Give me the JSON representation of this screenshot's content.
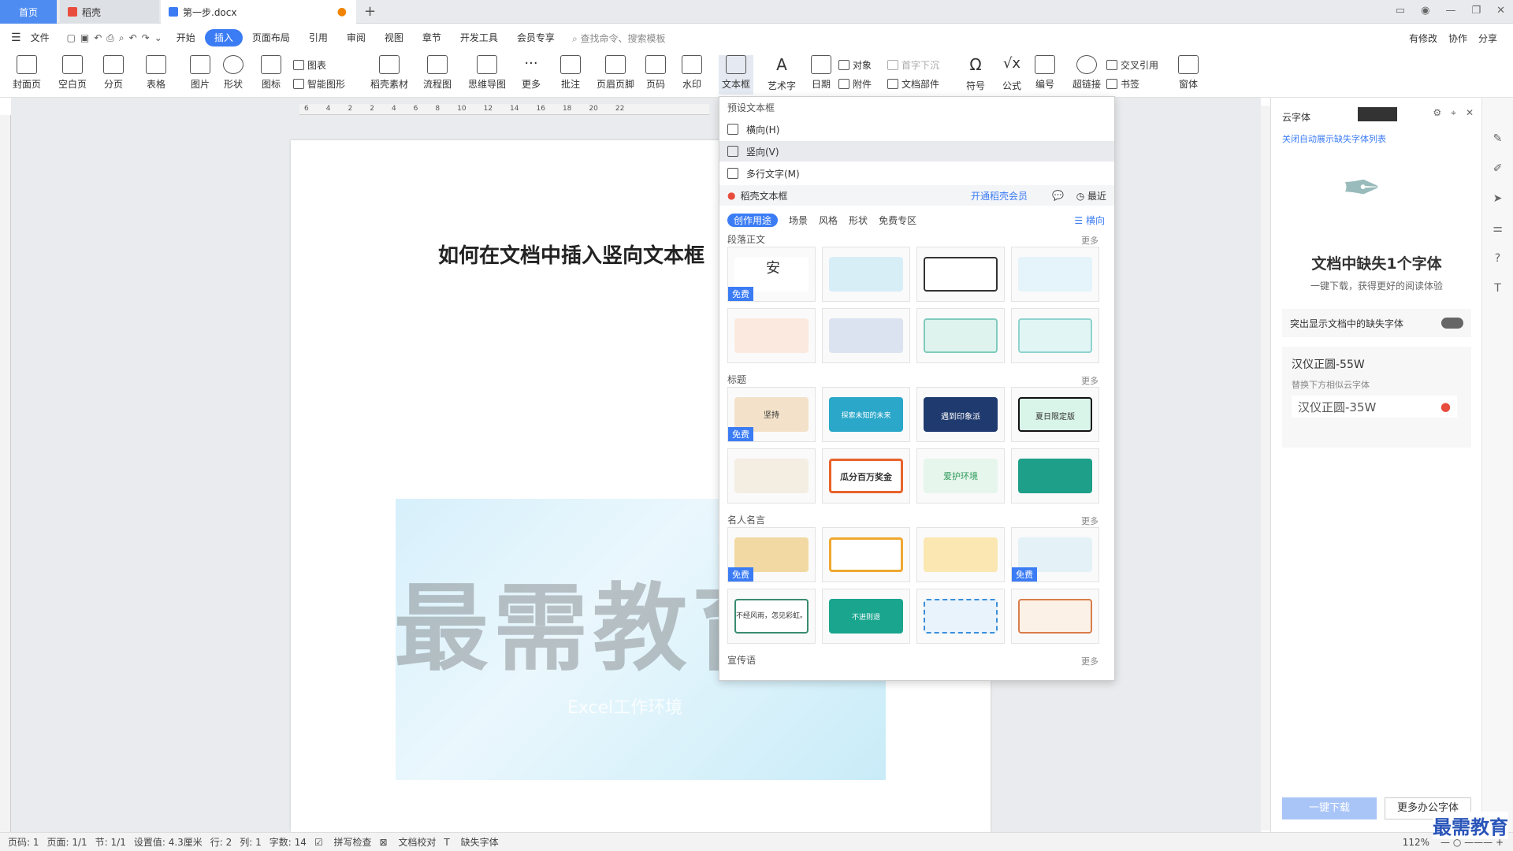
{
  "tabs": {
    "home": "首页",
    "daoke": "稻壳",
    "doc": "第一步.docx",
    "new": "+"
  },
  "menu": {
    "file": "文件",
    "items": [
      "开始",
      "插入",
      "页面布局",
      "引用",
      "审阅",
      "视图",
      "章节",
      "开发工具",
      "会员专享"
    ],
    "search": "查找命令、搜索模板",
    "right": [
      "有修改",
      "协作",
      "分享"
    ]
  },
  "ribbon": {
    "cover": "封面页",
    "blank": "空白页",
    "break": "分页",
    "table": "表格",
    "picture": "图片",
    "shape": "形状",
    "icon": "图标",
    "chart": "图表",
    "smart": "智能图形",
    "material": "稻壳素材",
    "flow": "流程图",
    "mind": "思维导图",
    "more": "更多",
    "comment": "批注",
    "header": "页眉页脚",
    "pageno": "页码",
    "watermark": "水印",
    "textbox": "文本框",
    "wordart": "艺术字",
    "date": "日期",
    "object": "对象",
    "attach": "附件",
    "dropcap": "首字下沉",
    "docpart": "文档部件",
    "symbol": "符号",
    "formula": "公式",
    "numbering": "编号",
    "hyperlink": "超链接",
    "crossref": "交叉引用",
    "bookmark": "书签",
    "window": "窗体"
  },
  "ruler": [
    "6",
    "4",
    "2",
    "2",
    "4",
    "6",
    "8",
    "10",
    "12",
    "14",
    "16",
    "18",
    "20",
    "22"
  ],
  "document": {
    "title": "如何在文档中插入竖向文本框",
    "watermark": "最需教育",
    "watermark_sub": "Excel工作环境"
  },
  "dropdown": {
    "preset_title": "预设文本框",
    "items": [
      "横向(H)",
      "竖向(V)",
      "多行文字(M)"
    ],
    "daoke_title": "稻壳文本框",
    "vip": "开通稻壳会员",
    "recent": "最近",
    "subtabs": [
      "创作用途",
      "场景",
      "风格",
      "形状",
      "免费专区"
    ],
    "orient": "横向",
    "sections": [
      "段落正文",
      "标题",
      "名人名言",
      "宣传语"
    ],
    "more": "更多",
    "free": "免费",
    "thumb_texts": [
      "安",
      "",
      "",
      "",
      "",
      "",
      "",
      "",
      "坚持",
      "探索未知的未来",
      "遇到印象派",
      "夏日限定版",
      "",
      "瓜分百万奖金",
      "爱护环境",
      "",
      "",
      "",
      "",
      "",
      "不经风雨，怎见彩虹。",
      "不进则退",
      "",
      ""
    ]
  },
  "side": {
    "title": "云字体",
    "close_auto": "关闭自动展示缺失字体列表",
    "missing": "文档中缺失1个字体",
    "missing_sub": "一键下载，获得更好的阅读体验",
    "toggle_label": "突出显示文档中的缺失字体",
    "font_name": "汉仪正圆-55W",
    "replace_hint": "替换下方相似云字体",
    "replace_font": "汉仪正圆-35W",
    "download": "一键下载",
    "more_fonts": "更多办公字体"
  },
  "status": {
    "page": "页码: 1",
    "pages": "页面: 1/1",
    "section": "节: 1/1",
    "setting": "设置值: 4.3厘米",
    "row": "行: 2",
    "col": "列: 1",
    "words": "字数: 14",
    "spell": "拼写检查",
    "proof": "文档校对",
    "missing": "缺失字体",
    "zoom": "112%"
  },
  "corner_logo": "最需教育",
  "colors": {
    "accent": "#3b7cf5",
    "tab_home": "#4f8cf2",
    "vip": "#3b7cf5"
  }
}
